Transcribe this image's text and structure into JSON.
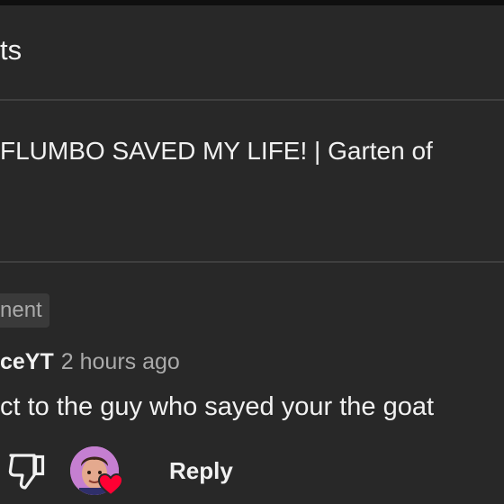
{
  "header": {
    "title": "ts"
  },
  "video": {
    "title": "FLUMBO SAVED MY LIFE! | Garten of"
  },
  "chip": {
    "label": "nent"
  },
  "comment": {
    "author": "ceYT",
    "timestamp": "2 hours ago",
    "text": "ct to the guy who sayed your the goat",
    "heart_icon": "heart-icon",
    "dislike_icon": "thumbs-down-icon"
  },
  "actions": {
    "reply_label": "Reply"
  },
  "colors": {
    "background": "#282828",
    "divider": "#3f3f3f",
    "heart": "#ff0033",
    "secondary_text": "#aaaaaa"
  }
}
